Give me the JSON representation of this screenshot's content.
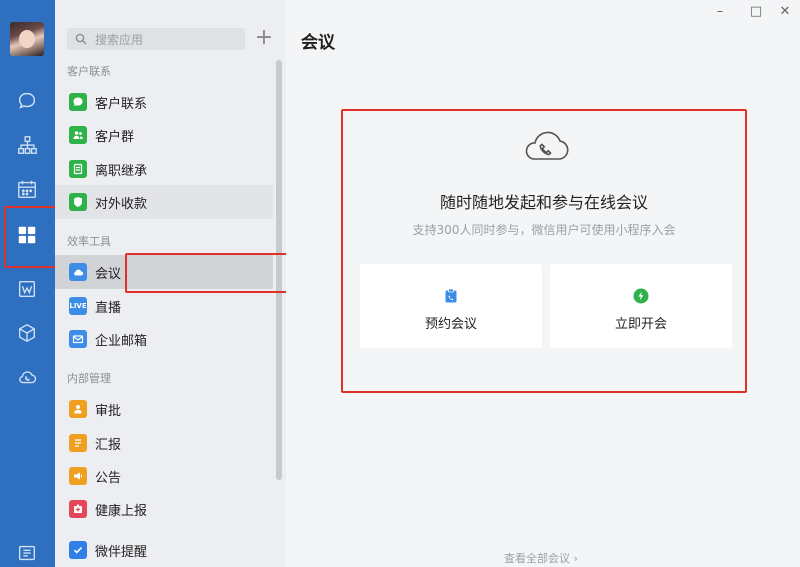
{
  "rail": {
    "icons": [
      "chat-icon",
      "contacts-icon",
      "calendar-icon",
      "workbench-icon",
      "doc-icon",
      "cube-icon",
      "cloud-call-icon",
      "settings-icon"
    ]
  },
  "panel": {
    "search_placeholder": "搜索应用",
    "add_label": "+",
    "sections": {
      "customer": "客户联系",
      "efficiency": "效率工具",
      "internal": "内部管理"
    },
    "items": [
      {
        "label": "客户联系",
        "color": "#2fb24a"
      },
      {
        "label": "客户群",
        "color": "#2fb24a"
      },
      {
        "label": "离职继承",
        "color": "#2fb24a"
      },
      {
        "label": "对外收款",
        "color": "#2fb24a"
      },
      {
        "label": "会议",
        "color": "#3c8de6"
      },
      {
        "label": "直播",
        "badge": "LIVE",
        "color": "#3c8de6"
      },
      {
        "label": "企业邮箱",
        "color": "#3c8de6"
      },
      {
        "label": "审批",
        "color": "#f0a020"
      },
      {
        "label": "汇报",
        "color": "#f0a020"
      },
      {
        "label": "公告",
        "color": "#f0a020"
      },
      {
        "label": "健康上报",
        "color": "#e6475a"
      },
      {
        "label": "微伴提醒",
        "color": "#2f7fe6"
      }
    ]
  },
  "main": {
    "title": "会议",
    "window": {
      "minimize": "–",
      "maximize": "□",
      "close": "✕"
    },
    "card": {
      "headline": "随时随地发起和参与在线会议",
      "sub": "支持300人同时参与，微信用户可使用小程序入会",
      "schedule_label": "预约会议",
      "start_label": "立即开会"
    },
    "footer_link": "查看全部会议 ›"
  }
}
